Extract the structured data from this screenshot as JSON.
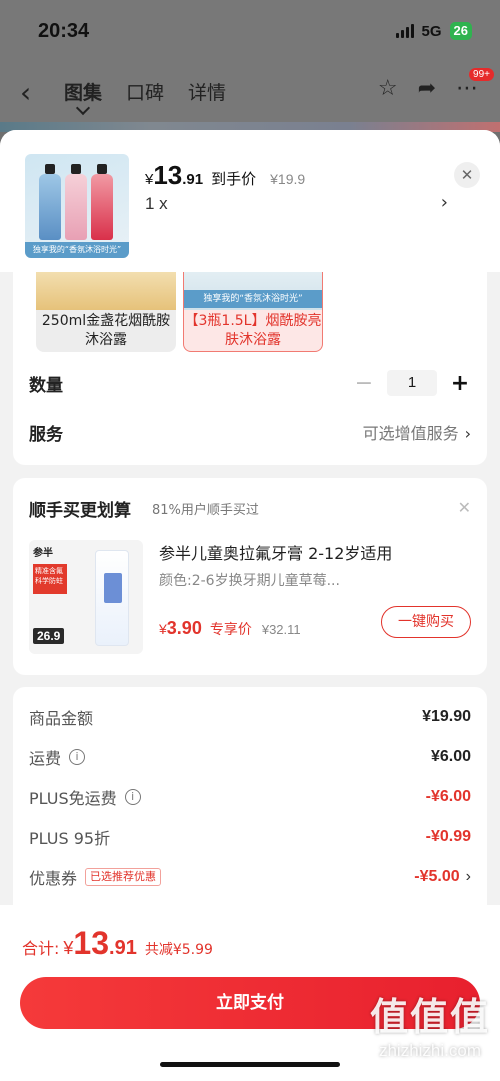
{
  "status_bar": {
    "time": "20:34",
    "network": "5G",
    "battery": "26"
  },
  "nav": {
    "tabs": [
      {
        "label": "图集",
        "active": true
      },
      {
        "label": "口碑",
        "active": false
      },
      {
        "label": "详情",
        "active": false
      }
    ],
    "badge": "99+"
  },
  "product": {
    "thumb_caption": "独享我的“香氛沐浴时光”",
    "price_yen": "¥",
    "price_int": "13",
    "price_dec": ".91",
    "price_label": "到手价",
    "original_price": "¥19.9",
    "quantity_text": "1 x"
  },
  "variants": [
    {
      "label": "250ml金盏花烟酰胺沐浴露",
      "selected": false
    },
    {
      "label": "【3瓶1.5L】烟酰胺亮肤沐浴露",
      "selected": true,
      "caption": "独享我的“香氛沐浴时光”"
    }
  ],
  "quantity": {
    "label": "数量",
    "value": "1",
    "minus": "−",
    "plus": "+"
  },
  "service": {
    "label": "服务",
    "value": "可选增值服务"
  },
  "recommend": {
    "title": "顺手买更划算",
    "subtitle": "81%用户顺手买过",
    "brand": "参半",
    "badge_text": "精准含氟科学防蛀",
    "tag_price": "26.9",
    "name": "参半儿童奥拉氟牙膏 2-12岁适用",
    "variant": "颜色:2-6岁换牙期儿童草莓...",
    "price_yen": "¥",
    "price": "3.90",
    "price_label": "专享价",
    "original_price": "¥32.11",
    "buy_label": "一键购买"
  },
  "summary": {
    "rows": [
      {
        "label": "商品金额",
        "value": "¥19.90",
        "negative": false,
        "info": false
      },
      {
        "label": "运费",
        "value": "¥6.00",
        "negative": false,
        "info": true
      },
      {
        "label": "PLUS免运费",
        "value": "-¥6.00",
        "negative": true,
        "info": true
      },
      {
        "label": "PLUS 95折",
        "value": "-¥0.99",
        "negative": true,
        "info": false
      }
    ],
    "coupon": {
      "label": "优惠券",
      "tag": "已选推荐优惠",
      "value": "-¥5.00"
    }
  },
  "footer": {
    "total_label": "合计:",
    "total_yen": "¥",
    "total_int": "13",
    "total_dec": ".91",
    "savings": "共减¥5.99",
    "pay_label": "立即支付"
  },
  "watermark": {
    "logo": "值值值",
    "url": "zhizhizhi.com"
  },
  "colors": {
    "accent": "#e2342c",
    "pay_button": "#f0303a"
  }
}
